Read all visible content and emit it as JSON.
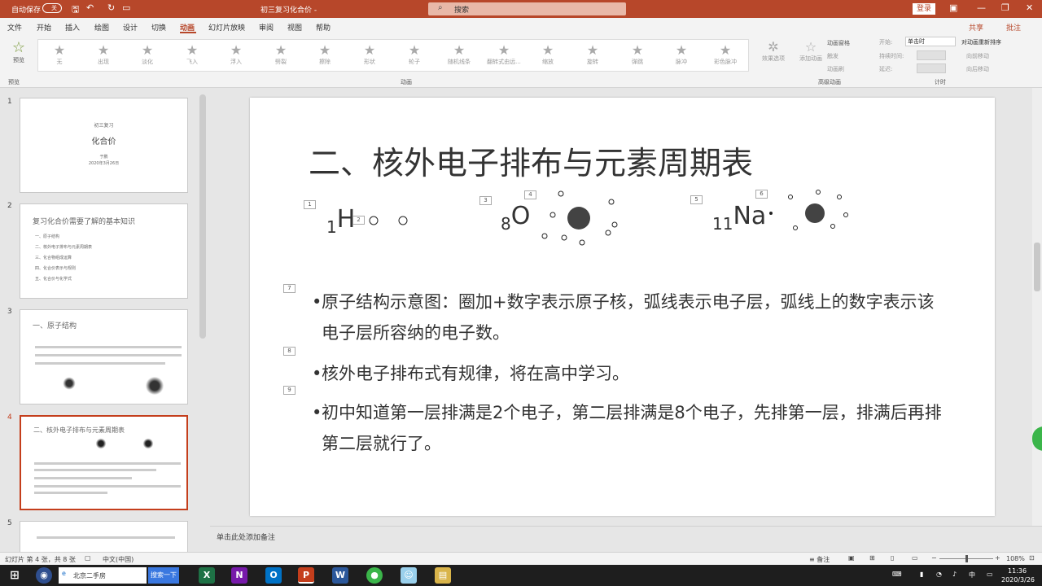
{
  "titlebar": {
    "autosave": "自动保存",
    "autosave_state": "关",
    "doc_title": "初三复习化合价 -",
    "search_placeholder": "搜索",
    "login": "登录"
  },
  "tabs": [
    "文件",
    "开始",
    "插入",
    "绘图",
    "设计",
    "切换",
    "动画",
    "幻灯片放映",
    "审阅",
    "视图",
    "帮助"
  ],
  "tabs_right": {
    "share": "共享",
    "comment": "批注"
  },
  "ribbon": {
    "preview": "预览",
    "preview_group": "预览",
    "animations": [
      "无",
      "出现",
      "淡化",
      "飞入",
      "浮入",
      "劈裂",
      "擦除",
      "形状",
      "轮子",
      "随机线条",
      "翻转式由远...",
      "缩放",
      "旋转",
      "弹跳",
      "脉冲",
      "彩色脉冲"
    ],
    "anim_group": "动画",
    "effect_options": "效果选项",
    "add_anim": "添加动画",
    "anim_pane": "动画窗格",
    "trigger": "触发",
    "anim_painter": "动画刷",
    "adv_group": "高级动画",
    "start_label": "开始:",
    "start_value": "单击时",
    "duration_label": "持续时间:",
    "delay_label": "延迟:",
    "reorder": "对动画重新排序",
    "move_earlier": "向前移动",
    "move_later": "向后移动",
    "timing_group": "计时"
  },
  "thumbs": [
    {
      "num": "1",
      "title": "初三复习",
      "subtitle": "化合价",
      "meta": "于鹏",
      "date": "2020年3月26日"
    },
    {
      "num": "2",
      "title": "复习化合价需要了解的基本知识",
      "items": [
        "一、原子结构",
        "二、核外电子排布与元素周期表",
        "三、化合物组成运算",
        "四、化合价表示与规则",
        "五、化合价与化学式"
      ]
    },
    {
      "num": "3",
      "title": "一、原子结构"
    },
    {
      "num": "4",
      "title": "二、核外电子排布与元素周期表"
    },
    {
      "num": "5"
    }
  ],
  "slide": {
    "title": "二、核外电子排布与元素周期表",
    "atoms": [
      {
        "sub": "1",
        "sym": "H"
      },
      {
        "sub": "8",
        "sym": "O"
      },
      {
        "sub": "11",
        "sym": "Na"
      }
    ],
    "anim_tags": [
      "1",
      "2",
      "3",
      "4",
      "5",
      "6",
      "7",
      "8",
      "9"
    ],
    "bullets": [
      "原子结构示意图：圈加+数字表示原子核，弧线表示电子层，弧线上的数字表示该电子层所容纳的电子数。",
      "核外电子排布式有规律，将在高中学习。",
      "初中知道第一层排满是2个电子，第二层排满是8个电子，先排第一层，排满后再排第二层就行了。"
    ]
  },
  "notes_placeholder": "单击此处添加备注",
  "status": {
    "slide_info": "幻灯片 第 4 张，共 8 张",
    "language": "中文(中国)",
    "notes": "备注",
    "zoom": "108%"
  },
  "taskbar": {
    "browser_tab": "北京二手房",
    "search_btn": "搜索一下",
    "time": "11:36",
    "date": "2020/3/26"
  }
}
